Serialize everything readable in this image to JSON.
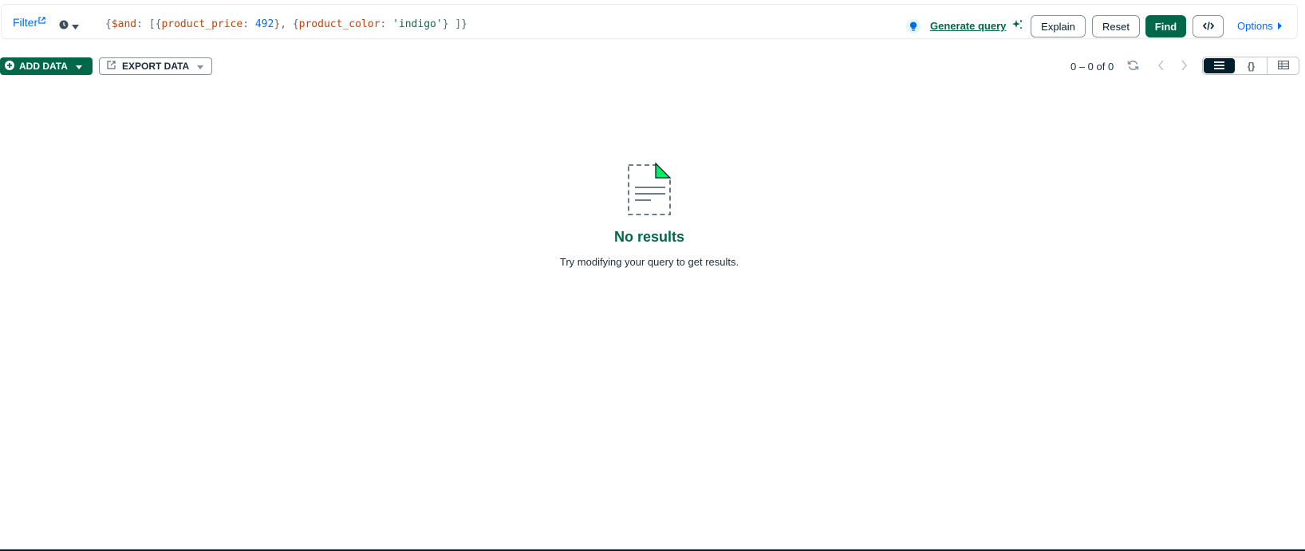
{
  "querybar": {
    "filter_label": "Filter",
    "query": {
      "open": "{",
      "and_op": "$and",
      "colon_bracket": ": [{",
      "price_key": "product_price",
      "sep1": ": ",
      "price_value": "492",
      "mid": "}, {",
      "color_key": "product_color",
      "sep2": ": ",
      "color_value": "'indigo'",
      "close": "} ]}"
    },
    "generate_query_label": "Generate query",
    "explain_label": "Explain",
    "reset_label": "Reset",
    "find_label": "Find",
    "options_label": "Options"
  },
  "toolbar": {
    "add_data_label": "ADD DATA",
    "export_data_label": "EXPORT DATA",
    "pagination": "0 – 0 of 0",
    "view_json_label": "{}"
  },
  "empty_state": {
    "title": "No results",
    "message": "Try modifying your query to get results."
  },
  "colors": {
    "accent": "#00684a",
    "link": "#016bf8",
    "dark": "#001e2b"
  },
  "icons": [
    "external-link-icon",
    "clock-icon",
    "caret-down-icon",
    "lightbulb-icon",
    "sparkle-icon",
    "code-icon",
    "caret-right-icon",
    "plus-circle-icon",
    "export-icon",
    "refresh-icon",
    "chevron-left-icon",
    "chevron-right-icon",
    "list-view-icon",
    "json-view-icon",
    "table-view-icon",
    "document-icon"
  ]
}
